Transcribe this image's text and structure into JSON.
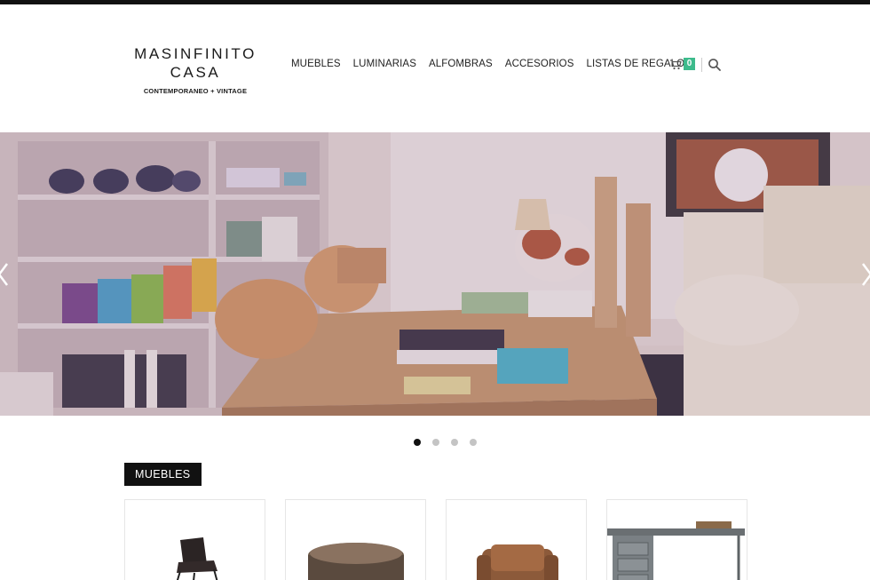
{
  "brand": {
    "name_line1": "MASINFINITO",
    "name_line2": "CASA",
    "tagline": "CONTEMPORANEO + VINTAGE"
  },
  "nav": {
    "items": [
      {
        "label": "MUEBLES"
      },
      {
        "label": "LUMINARIAS"
      },
      {
        "label": "ALFOMBRAS"
      },
      {
        "label": "ACCESORIOS"
      },
      {
        "label": "LISTAS DE REGALOS"
      }
    ]
  },
  "cart": {
    "count": "0",
    "icon": "cart-icon",
    "accent_color": "#3dbb8c"
  },
  "search": {
    "icon": "search-icon"
  },
  "hero": {
    "slide_count": 4,
    "active_slide": 1,
    "prev_icon": "chevron-left-icon",
    "next_icon": "chevron-right-icon"
  },
  "section": {
    "title": "MUEBLES"
  },
  "products": [
    {
      "image": "chair-image"
    },
    {
      "image": "round-table-image"
    },
    {
      "image": "armchair-image"
    },
    {
      "image": "desk-image"
    }
  ]
}
